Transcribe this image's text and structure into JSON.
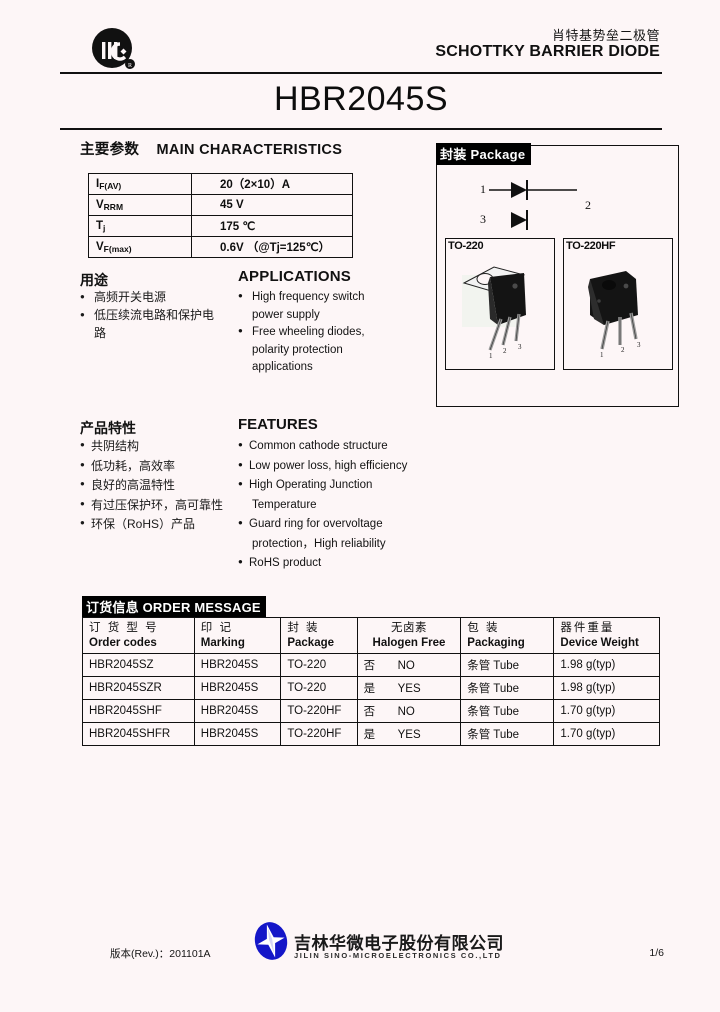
{
  "header": {
    "logo_alt": "JSMC logo",
    "title_cn": "肖特基势垒二极管",
    "title_en": "SCHOTTKY BARRIER DIODE",
    "part_number": "HBR2045S"
  },
  "main_characteristics": {
    "heading_cn": "主要参数",
    "heading_en": "MAIN  CHARACTERISTICS",
    "rows": [
      {
        "symbol": "I",
        "sub": "F(AV)",
        "value": "20（2×10）A"
      },
      {
        "symbol": "V",
        "sub": "RRM",
        "value": "45 V"
      },
      {
        "symbol": "T",
        "sub": "j",
        "value": "175 ℃"
      },
      {
        "symbol": "V",
        "sub": "F(max)",
        "value": "0.6V （@Tj=125℃）"
      }
    ]
  },
  "applications": {
    "heading_cn": "用途",
    "heading_en": "APPLICATIONS",
    "items_cn": [
      "高频开关电源",
      "低压续流电路和保护电",
      "路"
    ],
    "items_en": [
      "High frequency switch",
      "power supply",
      "Free wheeling diodes,",
      "polarity protection",
      "applications"
    ]
  },
  "features": {
    "heading_cn": "产品特性",
    "heading_en": "FEATURES",
    "items_cn": [
      "共阴结构",
      "低功耗，高效率",
      "良好的高温特性",
      "有过压保护环，高可靠性",
      "环保（RoHS）产品"
    ],
    "items_en": [
      "Common cathode structure",
      "Low power loss, high efficiency",
      "High Operating Junction",
      "Temperature",
      "Guard ring for overvoltage",
      "protection，High reliability",
      "RoHS product"
    ]
  },
  "package": {
    "heading_cn": "封装",
    "heading_en": "Package",
    "heading_full": "封装 Package",
    "schematic": {
      "pin1": "1",
      "pin2": "2",
      "pin3": "3",
      "configuration": "common cathode dual diode"
    },
    "variants": [
      {
        "label": "TO-220"
      },
      {
        "label": "TO-220HF"
      }
    ]
  },
  "order_message": {
    "heading_cn": "订货信息",
    "heading_en": "ORDER MESSAGE",
    "heading_full": "订货信息 ORDER MESSAGE",
    "columns": [
      {
        "cn": "订 货 型 号",
        "en": "Order codes"
      },
      {
        "cn": "印    记",
        "en": "Marking"
      },
      {
        "cn": "封    装",
        "en": "Package"
      },
      {
        "cn": "无卤素",
        "en": "Halogen Free"
      },
      {
        "cn": "包    装",
        "en": "Packaging"
      },
      {
        "cn": "器件重量",
        "en": "Device Weight"
      }
    ],
    "rows": [
      {
        "order_code": "HBR2045SZ",
        "marking": "HBR2045S",
        "package": "TO-220",
        "halogen_cn": "否",
        "halogen_en": "NO",
        "packaging_cn": "条管",
        "packaging_en": "Tube",
        "weight": "1.98 g(typ)"
      },
      {
        "order_code": "HBR2045SZR",
        "marking": "HBR2045S",
        "package": "TO-220",
        "halogen_cn": "是",
        "halogen_en": "YES",
        "packaging_cn": "条管",
        "packaging_en": "Tube",
        "weight": "1.98 g(typ)"
      },
      {
        "order_code": "HBR2045SHF",
        "marking": "HBR2045S",
        "package": "TO-220HF",
        "halogen_cn": "否",
        "halogen_en": "NO",
        "packaging_cn": "条管",
        "packaging_en": "Tube",
        "weight": "1.70 g(typ)"
      },
      {
        "order_code": "HBR2045SHFR",
        "marking": "HBR2045S",
        "package": "TO-220HF",
        "halogen_cn": "是",
        "halogen_en": "YES",
        "packaging_cn": "条管",
        "packaging_en": "Tube",
        "weight": "1.70 g(typ)"
      }
    ]
  },
  "footer": {
    "revision": "版本(Rev.)：201101A",
    "company_cn": "吉林华微电子股份有限公司",
    "company_en": "JILIN SINO-MICROELECTRONICS CO.,LTD",
    "page": "1/6",
    "logo_color": "#1416c8"
  }
}
